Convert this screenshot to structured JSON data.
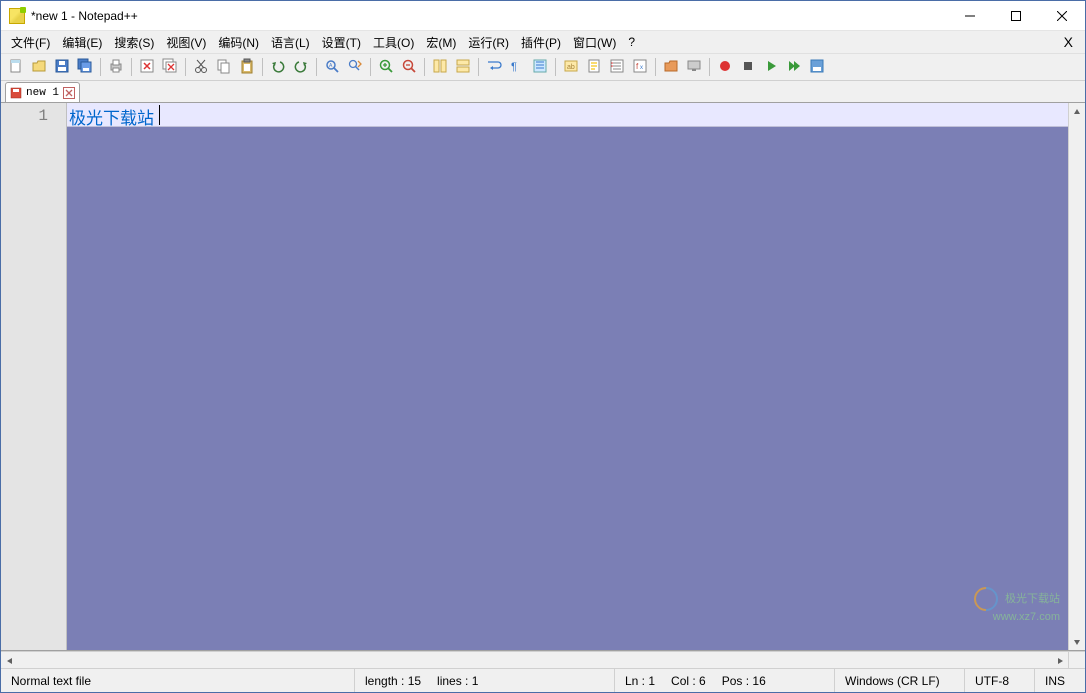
{
  "title": "*new 1 - Notepad++",
  "menu": [
    "文件(F)",
    "编辑(E)",
    "搜索(S)",
    "视图(V)",
    "编码(N)",
    "语言(L)",
    "设置(T)",
    "工具(O)",
    "宏(M)",
    "运行(R)",
    "插件(P)",
    "窗口(W)",
    "?"
  ],
  "menu_close": "X",
  "toolbar_icons": [
    "new-file-icon",
    "open-file-icon",
    "save-icon",
    "save-all-icon",
    "sep",
    "print-icon",
    "sep",
    "close-icon",
    "close-all-icon",
    "sep",
    "cut-icon",
    "copy-icon",
    "paste-icon",
    "sep",
    "undo-icon",
    "redo-icon",
    "sep",
    "find-icon",
    "replace-icon",
    "sep",
    "zoom-in-icon",
    "zoom-out-icon",
    "sep",
    "sync-v-icon",
    "sync-h-icon",
    "sep",
    "wrap-icon",
    "all-chars-icon",
    "indent-guide-icon",
    "sep",
    "lang-icon",
    "doc-map-icon",
    "doc-list-icon",
    "func-list-icon",
    "sep",
    "folder-icon",
    "monitor-icon",
    "sep",
    "record-icon",
    "stop-icon",
    "play-icon",
    "play-multi-icon",
    "save-macro-icon"
  ],
  "tabs": [
    {
      "label": "new 1",
      "modified": true
    }
  ],
  "editor": {
    "line_number": "1",
    "content": "极光下载站",
    "selection_background": "#7b7fb5"
  },
  "status": {
    "file_type": "Normal text file",
    "length_label": "length : 15",
    "lines_label": "lines : 1",
    "ln_label": "Ln : 1",
    "col_label": "Col : 6",
    "pos_label": "Pos : 16",
    "eol": "Windows (CR LF)",
    "encoding": "UTF-8",
    "mode": "INS"
  },
  "watermark": {
    "brand": "极光下载站",
    "url": "www.xz7.com"
  }
}
